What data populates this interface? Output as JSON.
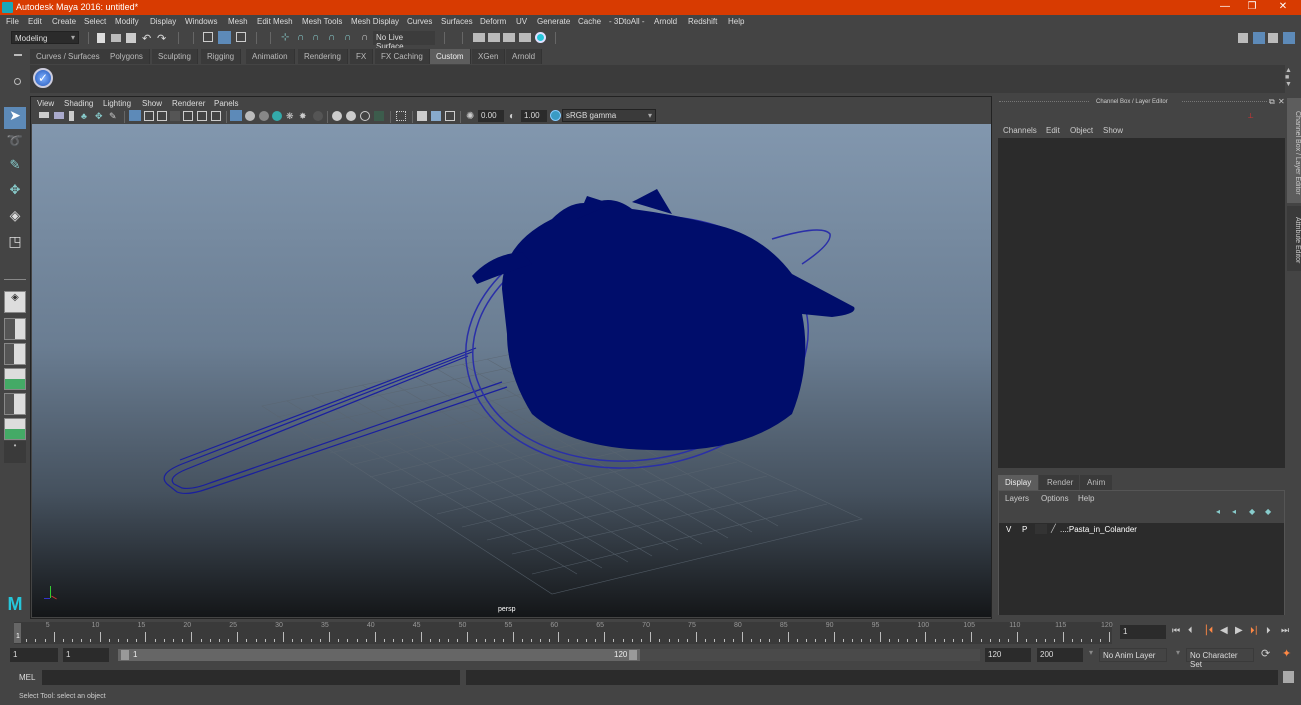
{
  "window": {
    "title": "Autodesk Maya 2016: untitled*",
    "minimize": "—",
    "maximize": "❐",
    "close": "✕"
  },
  "menubar": [
    "File",
    "Edit",
    "Create",
    "Select",
    "Modify",
    "Display",
    "Windows",
    "Mesh",
    "Edit Mesh",
    "Mesh Tools",
    "Mesh Display",
    "Curves",
    "Surfaces",
    "Deform",
    "UV",
    "Generate",
    "Cache",
    "- 3DtoAll -",
    "Arnold",
    "Redshift",
    "Help"
  ],
  "statusline": {
    "mode": "Modeling",
    "live_surface": "No Live Surface"
  },
  "shelf_tabs": [
    {
      "label": "Curves / Surfaces"
    },
    {
      "label": "Polygons"
    },
    {
      "label": "Sculpting"
    },
    {
      "label": "Rigging"
    },
    {
      "label": "Animation"
    },
    {
      "label": "Rendering"
    },
    {
      "label": "FX"
    },
    {
      "label": "FX Caching"
    },
    {
      "label": "Custom",
      "active": true
    },
    {
      "label": "XGen"
    },
    {
      "label": "Arnold"
    }
  ],
  "viewport": {
    "menu": [
      "View",
      "Shading",
      "Lighting",
      "Show",
      "Renderer",
      "Panels"
    ],
    "exposure": "0.00",
    "gamma": "1.00",
    "color_space": "sRGB gamma",
    "camera_label": "persp",
    "object_color": "#000d6b"
  },
  "channel_box": {
    "title": "Channel Box / Layer Editor",
    "menu": [
      "Channels",
      "Edit",
      "Object",
      "Show"
    ]
  },
  "layer_editor": {
    "tabs": [
      {
        "label": "Display",
        "active": true
      },
      {
        "label": "Render"
      },
      {
        "label": "Anim"
      }
    ],
    "menu": [
      "Layers",
      "Options",
      "Help"
    ],
    "layers": [
      {
        "v": "V",
        "p": "P",
        "name": "...:Pasta_in_Colander"
      }
    ]
  },
  "side_tabs": [
    "Channel Box / Layer Editor",
    "Attribute Editor"
  ],
  "timeline": {
    "ticks": [
      "5",
      "10",
      "15",
      "20",
      "25",
      "30",
      "35",
      "40",
      "45",
      "50",
      "55",
      "60",
      "65",
      "70",
      "75",
      "80",
      "85",
      "90",
      "95",
      "100",
      "105",
      "110",
      "115",
      "120"
    ],
    "current_frame": "1",
    "current_frame_field": "1"
  },
  "range": {
    "start": "1",
    "playback_start": "1",
    "slider_start": "1",
    "slider_end": "120",
    "playback_end": "120",
    "end": "200",
    "anim_layer": "No Anim Layer",
    "character_set": "No Character Set"
  },
  "command_line": {
    "label": "MEL"
  },
  "help_line": "Select Tool: select an object"
}
